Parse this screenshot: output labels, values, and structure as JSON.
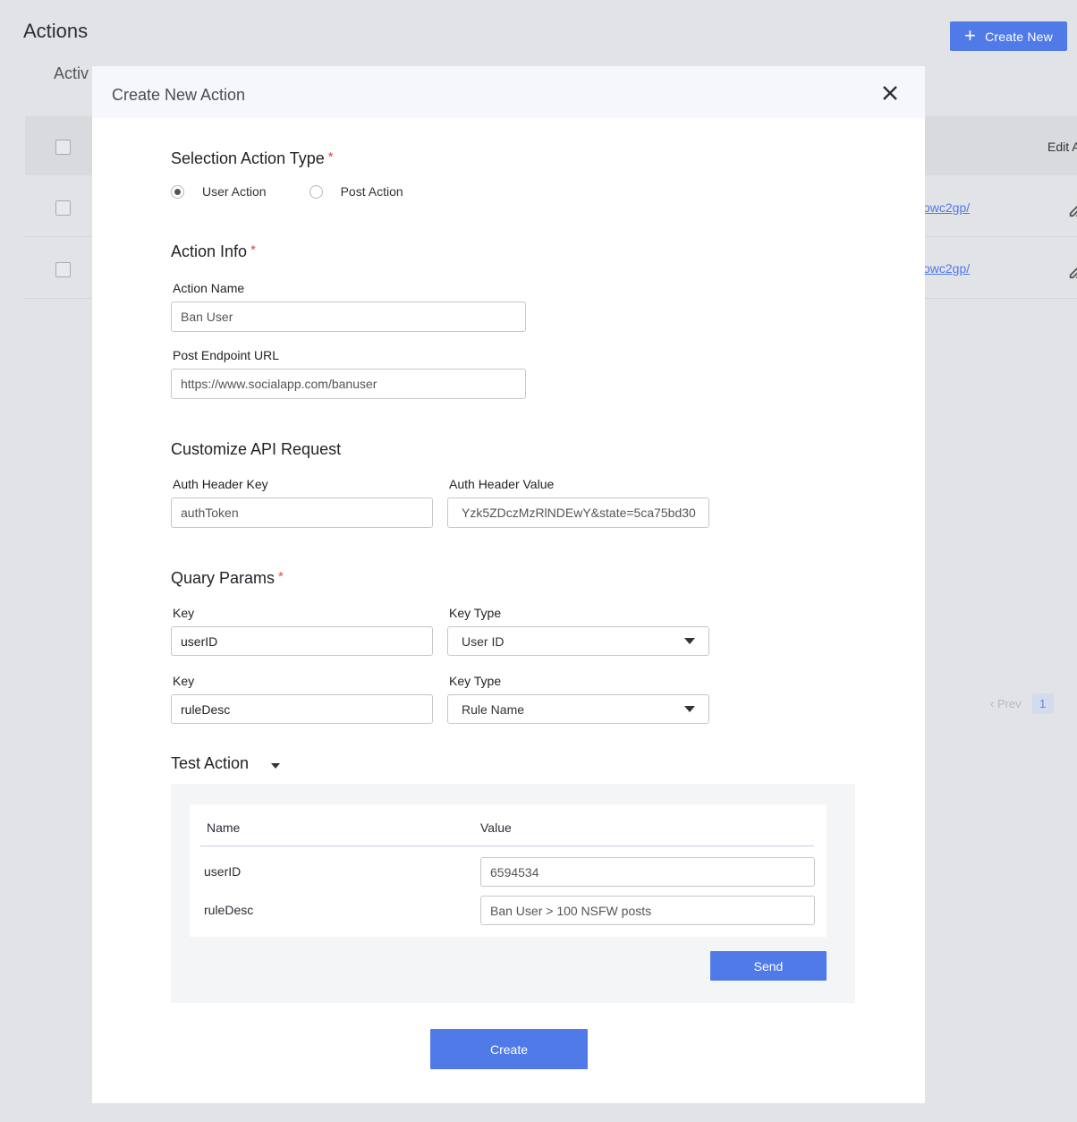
{
  "page": {
    "title": "Actions",
    "tab_label": "Activ",
    "create_new_label": "Create New",
    "edit_column_header": "Edit A",
    "rows": [
      {
        "link": "owc2gp/"
      },
      {
        "link": "owc2gp/"
      }
    ],
    "pager": {
      "prev": "‹ Prev",
      "page": "1"
    }
  },
  "modal": {
    "title": "Create New Action",
    "action_type": {
      "heading": "Selection Action Type",
      "required": "*",
      "options": [
        "User Action",
        "Post Action"
      ],
      "selected": "User Action"
    },
    "action_info": {
      "heading": "Action Info",
      "required": "*",
      "name_label": "Action Name",
      "name_value": "Ban User",
      "url_label": "Post Endpoint URL",
      "url_value": "https://www.socialapp.com/banuser"
    },
    "api_request": {
      "heading": "Customize API Request",
      "key_label": "Auth Header Key",
      "key_value": "authToken",
      "value_label": "Auth Header Value",
      "value_value": "Yzk5ZDczMzRlNDEwY&state=5ca75bd30"
    },
    "query_params": {
      "heading": "Quary Params",
      "required": "*",
      "rows": [
        {
          "key_label": "Key",
          "key_value": "userID",
          "type_label": "Key Type",
          "type_value": "User ID"
        },
        {
          "key_label": "Key",
          "key_value": "ruleDesc",
          "type_label": "Key Type",
          "type_value": "Rule Name"
        }
      ]
    },
    "test_action": {
      "heading": "Test Action",
      "col_name": "Name",
      "col_value": "Value",
      "rows": [
        {
          "name": "userID",
          "value": "6594534"
        },
        {
          "name": "ruleDesc",
          "value": "Ban User > 100 NSFW posts"
        }
      ],
      "send_label": "Send"
    },
    "create_label": "Create"
  },
  "colors": {
    "accent": "#4f7ae8",
    "required": "#e0484a",
    "overlay": "#e2e3e7"
  }
}
